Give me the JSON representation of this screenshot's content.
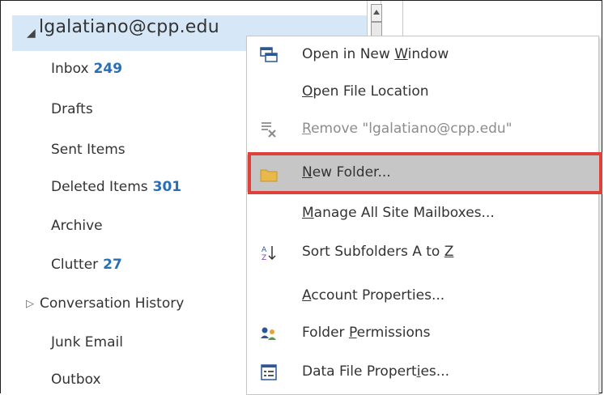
{
  "account": {
    "arrow": "◢",
    "name": "lgalatiano@cpp.edu"
  },
  "folders": [
    {
      "name": "Inbox",
      "count": "249"
    },
    {
      "name": "Drafts",
      "count": ""
    },
    {
      "name": "Sent Items",
      "count": ""
    },
    {
      "name": "Deleted Items",
      "count": "301"
    },
    {
      "name": "Archive",
      "count": ""
    },
    {
      "name": "Clutter",
      "count": "27"
    },
    {
      "name": "Conversation History",
      "count": "",
      "expand": "▷"
    },
    {
      "name": "Junk Email",
      "count": ""
    },
    {
      "name": "Outbox",
      "count": ""
    }
  ],
  "menu": {
    "open_new_window": {
      "pre": "Open in New ",
      "key": "W",
      "post": "indow",
      "icon": "new-window-icon"
    },
    "open_file_location": {
      "pre": "",
      "key": "O",
      "post": "pen File Location"
    },
    "remove": {
      "pre": "",
      "key": "R",
      "post": "emove \"lgalatiano@cpp.edu\"",
      "icon": "remove-icon"
    },
    "new_folder": {
      "pre": "",
      "key": "N",
      "post": "ew Folder...",
      "icon": "folder-icon"
    },
    "manage_mailboxes": {
      "pre": "",
      "key": "M",
      "post": "anage All Site Mailboxes..."
    },
    "sort_subfolders": {
      "pre": "Sort Subfolders A to ",
      "key": "Z",
      "post": "",
      "icon": "sort-az-icon"
    },
    "account_properties": {
      "pre": "",
      "key": "A",
      "post": "ccount Properties..."
    },
    "folder_permissions": {
      "pre": "Folder ",
      "key": "P",
      "post": "ermissions",
      "icon": "permissions-icon"
    },
    "data_file_properties": {
      "pre": "Data File Propert",
      "key": "i",
      "post": "es...",
      "icon": "data-file-icon"
    }
  },
  "colors": {
    "selection": "#d6e8f7",
    "count": "#2a6fb3",
    "highlight_border": "#e0403a",
    "menu_highlight": "#c6c6c6"
  }
}
